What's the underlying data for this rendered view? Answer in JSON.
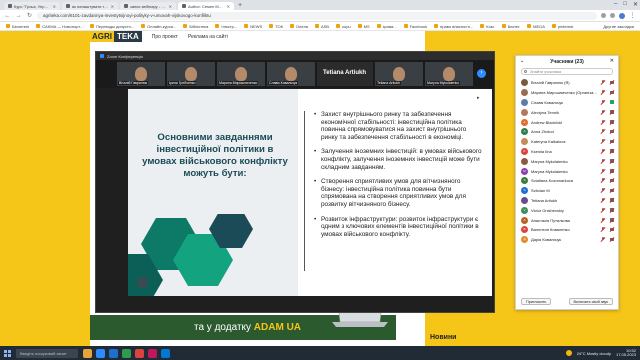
{
  "browser": {
    "tabs": [
      {
        "label": "Курс \"Гроші, Управління міст",
        "active": false
      },
      {
        "label": "як налаштувати тла та Бона",
        "active": false
      },
      {
        "label": "запис вебінару - Google Диск",
        "active": false
      },
      {
        "label": "Author: Семен Мобили Сотри",
        "active": true
      }
    ],
    "url": "agriteka.com/6101-zavdannya-investytsijnoyi-polityky-v-umovah-vijskovogo-konfliktu",
    "bookmarks": [
      "Бюлетені",
      "CAKMA — Новопорт...",
      "Переводы допустн...",
      "Онлайн-курси...",
      "Бібліотека",
      "Ілюстр...",
      "NEWS",
      "ТОК",
      "Олеля",
      "ASB",
      "zupu",
      "MS",
      "зрова...",
      "Facebook",
      "право власності...",
      "Ком.",
      "Бюлет.",
      "MEGA",
      "pinterest"
    ],
    "bookmarks_more": "Другие закладки"
  },
  "site": {
    "logo_part1": "AGRI",
    "logo_part2": "TEKA",
    "nav": [
      "Про проект",
      "Реклама на сайті"
    ],
    "banner_text": "та у додатку",
    "banner_brand": "ADAM UA",
    "sidebar_heading": "Новини"
  },
  "zoom": {
    "window_title": "Zoom Конференція",
    "thumbnails": [
      {
        "name": "Віталій Гаврилюк"
      },
      {
        "name": "Ірина Гребченко"
      },
      {
        "name": "Марина Мирошниченко"
      },
      {
        "name": "Славік Ковальчук"
      }
    ],
    "speaker": "Tetiana Artiukh",
    "speaker_thumbs": [
      "Tetiana Artiukh",
      "Maryna Mykolaienko"
    ]
  },
  "slide": {
    "heading": "Основними завданнями інвестиційної політики в умовах військового конфлікту можуть бути:",
    "bullets": [
      "Захист внутрішнього ринку та забезпечення економічної стабільності: інвестиційна політика повинна спрямовуватися на захист внутрішнього ринку та забезпечення стабільності в економіці.",
      "Залучення іноземних інвестицій: в умовах військового конфлікту, залучення іноземних інвестицій може бути складним завданням.",
      "Створення сприятливих умов для вітчизняного бізнесу: інвестиційна політика повинна бути спрямована на створення сприятливих умов для розвитку вітчизняного бізнесу.",
      "Розвиток інфраструктури: розвиток інфраструктури є одним з ключових елементів інвестиційної політики в умовах військового конфлікту."
    ]
  },
  "participants": {
    "title": "Учасники (23)",
    "search_placeholder": "Знайти учасника",
    "list": [
      {
        "name": "Віталій Гаврилюк (Я)",
        "color": "#7a5a3c",
        "initials": "",
        "mic": "muted",
        "cam": "off"
      },
      {
        "name": "Марина Мирошниченко (Організатор)",
        "color": "#9a6b4e",
        "initials": "",
        "mic": "muted",
        "cam": "off"
      },
      {
        "name": "Славік Ковальчук",
        "color": "#5b7ea8",
        "initials": "",
        "mic": "muted",
        "cam": "on"
      },
      {
        "name": "Alevtyna Tennik",
        "color": "#b07a5e",
        "initials": "",
        "mic": "muted",
        "cam": "off"
      },
      {
        "name": "Andrew Blackfold",
        "color": "#e06b2a",
        "initials": "A",
        "mic": "muted",
        "cam": "off"
      },
      {
        "name": "Anna Zholud",
        "color": "#2e7d4f",
        "initials": "A",
        "mic": "muted",
        "cam": "off"
      },
      {
        "name": "Kateryna Kalkalova",
        "color": "#c48b5b",
        "initials": "",
        "mic": "muted",
        "cam": "off"
      },
      {
        "name": "Kseniia Ilna",
        "color": "#d9453d",
        "initials": "K",
        "mic": "muted",
        "cam": "off"
      },
      {
        "name": "Maryna Mykolaienko",
        "color": "#8e5a3f",
        "initials": "",
        "mic": "muted",
        "cam": "off"
      },
      {
        "name": "Maryna Mykolaienko",
        "color": "#8c3fb0",
        "initials": "M",
        "mic": "muted",
        "cam": "off"
      },
      {
        "name": "Sviatlana Kozomarkova",
        "color": "#3c7a3c",
        "initials": "S",
        "mic": "muted",
        "cam": "off"
      },
      {
        "name": "Svitolan M",
        "color": "#1f6fd1",
        "initials": "S",
        "mic": "muted",
        "cam": "off"
      },
      {
        "name": "Tetiana Artiukh",
        "color": "#6a4b8c",
        "initials": "",
        "mic": "muted",
        "cam": "off"
      },
      {
        "name": "Victor Onishevskiy",
        "color": "#3b8e5a",
        "initials": "V",
        "mic": "muted",
        "cam": "off"
      },
      {
        "name": "Анастасія Путилкова",
        "color": "#b5651d",
        "initials": "A",
        "mic": "muted",
        "cam": "off"
      },
      {
        "name": "Валентин Коваленко",
        "color": "#d9453d",
        "initials": "B",
        "mic": "muted",
        "cam": "off"
      },
      {
        "name": "Дарія Ковальчук",
        "color": "#e08a2a",
        "initials": "Д",
        "mic": "muted",
        "cam": "off"
      }
    ],
    "invite_label": "Пригласить",
    "mute_all_label": "Включить свой звук"
  },
  "taskbar": {
    "search_placeholder": "Введіть пошуковий запит",
    "weather": "24°C Mostly cloudy",
    "time": "10:52",
    "date": "17.05.2023",
    "app_colors": [
      "#e8a33d",
      "#2d8cff",
      "#1f6fd1",
      "#2e9b4f",
      "#d9453d",
      "#c2185b",
      "#0078d4"
    ]
  }
}
